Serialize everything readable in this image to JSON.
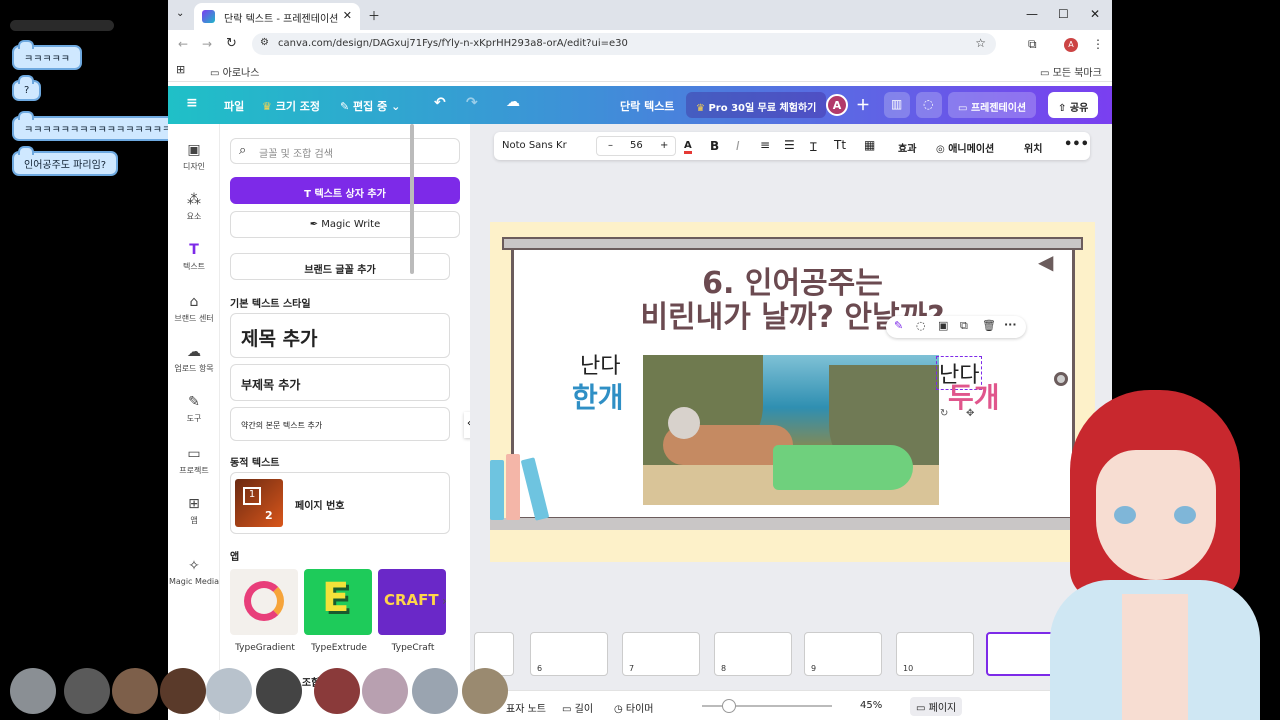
{
  "chat": {
    "messages": [
      "ㅋㅋㅋㅋㅋ",
      "?",
      "ㅋㅋㅋㅋㅋㅋㅋㅋㅋㅋㅋㅋㅋㅋㅋㅋㅋ",
      "인어공주도 파리임?"
    ]
  },
  "browser": {
    "tab_title": "단락 텍스트 - 프레젠테이션",
    "url": "canva.com/design/DAGxuj71Fys/fYly-n-xKprHH293a8-orA/edit?ui=e30",
    "bookmark_left": "아로나스",
    "bookmark_right": "모든 북마크"
  },
  "canva_header": {
    "file": "파일",
    "resize": "크기 조정",
    "editing": "편집 중",
    "doc_title": "단락 텍스트",
    "pro_trial": "Pro 30일 무료 체험하기",
    "avatar_initial": "A",
    "present": "프레젠테이션",
    "share": "공유"
  },
  "rail": {
    "items": [
      "디자인",
      "요소",
      "텍스트",
      "브랜드 센터",
      "업로드 항목",
      "도구",
      "프로젝트",
      "앱",
      "Magic Media"
    ]
  },
  "panel": {
    "search_placeholder": "글꼴 및 조합 검색",
    "add_textbox": "텍스트 상자 추가",
    "magic_write": "Magic Write",
    "brand_fonts": "브랜드 글꼴 추가",
    "basic_styles_title": "기본 텍스트 스타일",
    "heading": "제목 추가",
    "subheading": "부제목 추가",
    "body": "약간의 본문 텍스트 추가",
    "dynamic_title": "동적 텍스트",
    "page_number": "페이지 번호",
    "apps_title": "앱",
    "apps": [
      "TypeGradient",
      "TypeExtrude",
      "TypeCraft"
    ],
    "combos_title": "글꼴 조합"
  },
  "text_toolbar": {
    "font": "Noto Sans Kr",
    "size": "56",
    "effects": "효과",
    "animate": "애니메이션",
    "position": "위치"
  },
  "slide": {
    "title_line1": "6. 인어공주는",
    "title_line2": "비린내가 날까? 안날까?",
    "left_small": "난다",
    "left_big": "한개",
    "right_small": "난다",
    "right_big": "두개"
  },
  "thumbnails": {
    "pages": [
      "6",
      "7",
      "8",
      "9",
      "10"
    ]
  },
  "bottombar": {
    "notes": "표자 노트",
    "duration": "길이",
    "timer": "타이머",
    "zoom": "45%",
    "pages": "페이지"
  },
  "colors": {
    "canva_purple": "#7d2ae8",
    "slide_title": "#6b4a50",
    "blue_text": "#2f8fc5",
    "pink_text": "#e0568c",
    "slide_bg": "#fdf1c9"
  }
}
